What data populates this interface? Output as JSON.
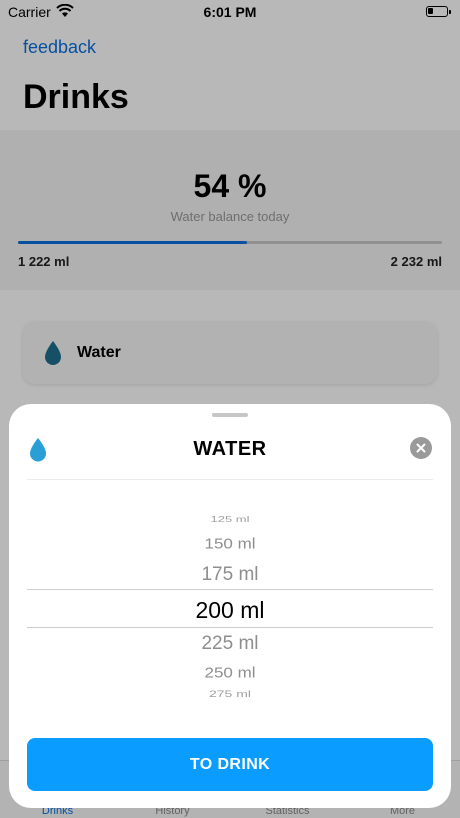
{
  "status_bar": {
    "carrier": "Carrier",
    "time": "6:01 PM"
  },
  "header": {
    "feedback_label": "feedback",
    "title": "Drinks"
  },
  "summary": {
    "percent_label": "54 %",
    "caption": "Water balance today",
    "progress_fraction": 0.54,
    "consumed": "1 222 ml",
    "target": "2 232 ml"
  },
  "drink_list": {
    "items": [
      {
        "label": "Water",
        "icon": "water-drop-icon"
      }
    ]
  },
  "tab_bar": {
    "items": [
      {
        "label": "Drinks",
        "active": true
      },
      {
        "label": "History",
        "active": false
      },
      {
        "label": "Statistics",
        "active": false
      },
      {
        "label": "More",
        "active": false
      }
    ]
  },
  "sheet": {
    "title": "WATER",
    "icon": "water-drop-icon",
    "close_icon": "close-icon",
    "picker": {
      "options": [
        "125 ml",
        "150 ml",
        "175 ml",
        "200 ml",
        "225 ml",
        "250 ml",
        "275 ml"
      ],
      "selected": "200 ml"
    },
    "action_label": "TO DRINK"
  },
  "colors": {
    "accent": "#0a6fe0",
    "button": "#0a9cff",
    "drop": "#2a9fd6"
  }
}
